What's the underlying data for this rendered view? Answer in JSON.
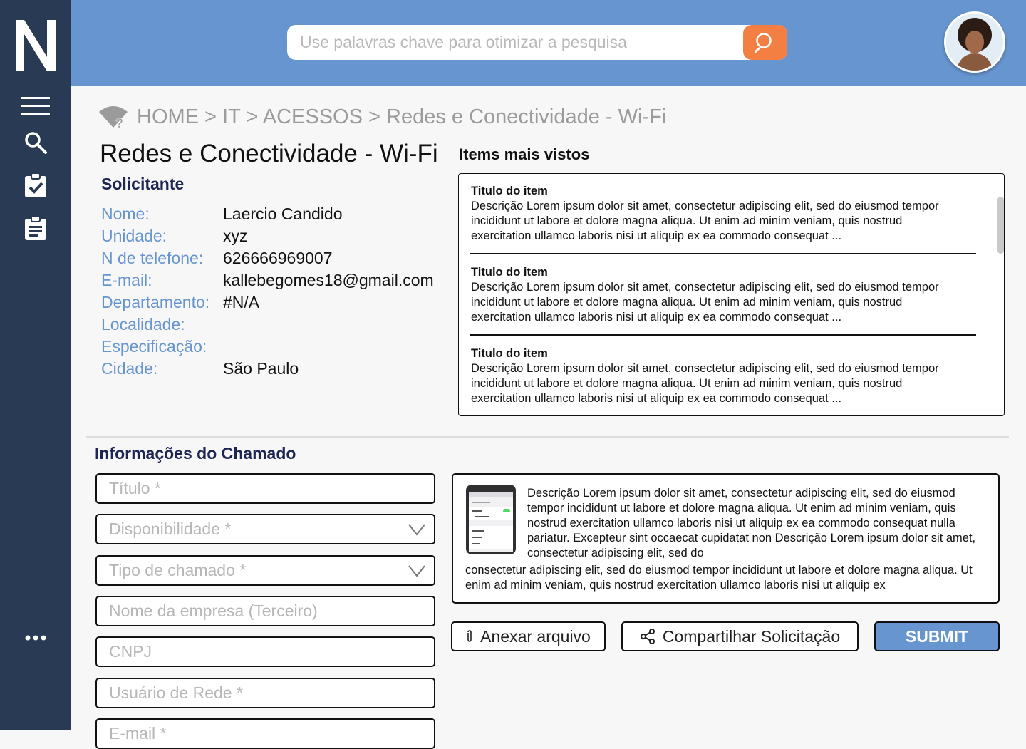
{
  "sidebar": {
    "logo_letter": "N",
    "items": [
      {
        "icon": "menu-icon"
      },
      {
        "icon": "search-icon"
      },
      {
        "icon": "clipboard-check-icon"
      },
      {
        "icon": "clipboard-list-icon"
      },
      {
        "icon": "more-icon"
      }
    ]
  },
  "header": {
    "search_placeholder": "Use palavras chave para otimizar a pesquisa",
    "search_button_icon": "search-icon",
    "avatar": "user-avatar"
  },
  "breadcrumb": {
    "icon": "wifi-help-icon",
    "text": "HOME > IT > ACESSOS > Redes e Conectividade - Wi-Fi"
  },
  "page_title": "Redes e Conectividade - Wi-Fi",
  "requester": {
    "section_title": "Solicitante",
    "fields": [
      {
        "label": "Nome:",
        "value": "Laercio Candido"
      },
      {
        "label": "Unidade:",
        "value": "xyz"
      },
      {
        "label": "N de telefone:",
        "value": "626666969007"
      },
      {
        "label": "E-mail:",
        "value": "kallebegomes18@gmail.com"
      },
      {
        "label": "Departamento:",
        "value": "#N/A"
      },
      {
        "label": "Localidade:",
        "value": ""
      },
      {
        "label": "Especificação:",
        "value": ""
      },
      {
        "label": "Cidade:",
        "value": "São Paulo"
      }
    ]
  },
  "most_viewed": {
    "title": "Items mais vistos",
    "items": [
      {
        "title": "Titulo do item",
        "description": "Descrição Lorem ipsum dolor sit amet, consectetur adipiscing elit, sed do eiusmod tempor incididunt ut labore et dolore magna aliqua. Ut enim ad minim veniam, quis nostrud exercitation ullamco laboris nisi ut aliquip ex ea commodo consequat ..."
      },
      {
        "title": "Titulo do item",
        "description": "Descrição Lorem ipsum dolor sit amet, consectetur adipiscing elit, sed do eiusmod tempor incididunt ut labore et dolore magna aliqua. Ut enim ad minim veniam, quis nostrud exercitation ullamco laboris nisi ut aliquip ex ea commodo consequat ..."
      },
      {
        "title": "Titulo do item",
        "description": "Descrição Lorem ipsum dolor sit amet, consectetur adipiscing elit, sed do eiusmod tempor incididunt ut labore et dolore magna aliqua. Ut enim ad minim veniam, quis nostrud exercitation ullamco laboris nisi ut aliquip ex ea commodo consequat ..."
      }
    ]
  },
  "ticket": {
    "section_title": "Informações do Chamado",
    "fields": [
      {
        "placeholder": "Título *",
        "value": "",
        "type": "text"
      },
      {
        "placeholder": "Disponibilidade *",
        "value": "",
        "type": "select"
      },
      {
        "placeholder": "Tipo de chamado *",
        "value": "",
        "type": "select"
      },
      {
        "placeholder": "Nome da empresa (Terceiro)",
        "value": "",
        "type": "text"
      },
      {
        "placeholder": "CNPJ",
        "value": "",
        "type": "text"
      },
      {
        "placeholder": "Usuário de Rede *",
        "value": "",
        "type": "text"
      },
      {
        "placeholder": "E-mail *",
        "value": "",
        "type": "text"
      }
    ],
    "description": {
      "image": "phone-wifi-settings-image",
      "text_part1": "Descrição Lorem ipsum dolor sit amet, consectetur adipiscing elit, sed do eiusmod tempor incididunt ut labore et dolore magna aliqua. Ut enim ad minim veniam, quis nostrud exercitation ullamco laboris nisi ut aliquip ex ea commodo consequat nulla pariatur. Excepteur sint occaecat cupidatat non Descrição Lorem ipsum dolor sit amet, consectetur adipiscing elit, sed do",
      "text_part2": "consectetur adipiscing elit, sed do eiusmod tempor incididunt ut labore et dolore magna aliqua. Ut enim ad minim veniam, quis nostrud exercitation ullamco laboris nisi ut aliquip ex"
    },
    "buttons": {
      "attach": {
        "label": "Anexar arquivo",
        "icon": "paperclip-icon"
      },
      "share": {
        "label": "Compartilhar Solicitação",
        "icon": "share-icon"
      },
      "submit": {
        "label": "SUBMIT"
      }
    }
  },
  "colors": {
    "sidebar": "#283a54",
    "header": "#6795cf",
    "accent": "#f47f42",
    "label": "#6795cf",
    "section_title": "#1d2552"
  }
}
